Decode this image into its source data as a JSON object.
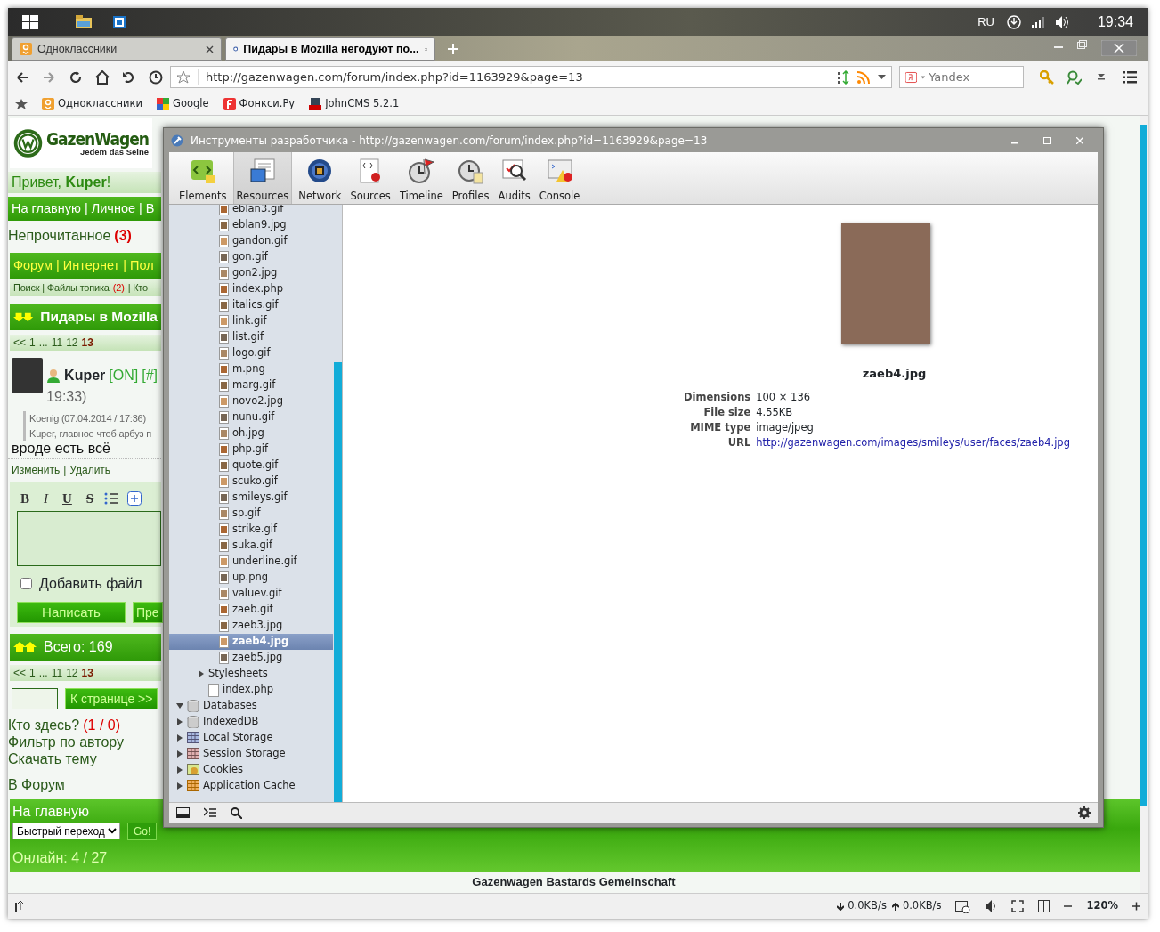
{
  "taskbar": {
    "language": "RU",
    "clock": "19:34"
  },
  "tabs": [
    {
      "label": "Одноклассники",
      "selected": false
    },
    {
      "label": "Пидары в Mozilla негодуют по...",
      "selected": true
    }
  ],
  "address_bar": {
    "url": "http://gazenwagen.com/forum/index.php?id=1163929&page=13"
  },
  "search": {
    "placeholder": "Yandex"
  },
  "bookmarks": [
    {
      "label": "Одноклассники",
      "kind": "ok"
    },
    {
      "label": "Google",
      "kind": "google"
    },
    {
      "label": "Фонкси.Ру",
      "kind": "fonksi"
    },
    {
      "label": "JohnCMS 5.2.1",
      "kind": "cms"
    }
  ],
  "page": {
    "logo": {
      "title": "GazenWagen",
      "slogan": "Jedem das Seine"
    },
    "greeting": "Привет, **Kuper**!",
    "nav": "На главную | Личное | В",
    "unread": {
      "label": "Непрочитанное",
      "count": "(3)"
    },
    "menu": "Форум | Интернет | Пол",
    "submenu": {
      "before": "Поиск | Файлы топика",
      "count": "(2)",
      "after": "| Кто"
    },
    "topic_title": "Пидары в Mozilla",
    "pager": [
      {
        "label": "<<",
        "selected": false
      },
      {
        "label": "1",
        "selected": false
      },
      {
        "label": "...",
        "selected": false
      },
      {
        "label": "11",
        "selected": false
      },
      {
        "label": "12",
        "selected": false
      },
      {
        "label": "13",
        "selected": true
      }
    ],
    "post": {
      "author": "Kuper",
      "status": "[ON]",
      "anchor": "[#]",
      "time": "19:33)",
      "quote_head": "Koenig (07.04.2014 / 17:36)",
      "quote_text": "Kuper, главное чтоб арбуз п",
      "text": "вроде есть всё",
      "actions": [
        "Изменить",
        "Удалить"
      ],
      "action_separator": "|"
    },
    "editor": {
      "format_buttons": [
        "B",
        "I",
        "U",
        "S"
      ],
      "add_file": {
        "label": "Добавить файл",
        "checked": false
      },
      "buttons": [
        "Написать",
        "Пре"
      ]
    },
    "total": "Всего: 169",
    "pager_bottom": [
      {
        "label": "<<",
        "selected": false
      },
      {
        "label": "1",
        "selected": false
      },
      {
        "label": "...",
        "selected": false
      },
      {
        "label": "11",
        "selected": false
      },
      {
        "label": "12",
        "selected": false
      },
      {
        "label": "13",
        "selected": true
      }
    ],
    "goto_button": "К странице >>",
    "who_here": {
      "label": "Кто здесь?",
      "count": "(1 / 0)"
    },
    "links": [
      "Фильтр по автору",
      "Скачать тему"
    ],
    "forum_link": "В Форум",
    "footer": {
      "home": "На главную",
      "quick_jump": "Быстрый переход",
      "go": "Go!",
      "online": "Онлайн: 4 / 27",
      "copyright": "Gazenwagen Bastards Gemeinschaft"
    }
  },
  "devtools": {
    "title": "Инструменты разработчика - http://gazenwagen.com/forum/index.php?id=1163929&page=13",
    "panels": [
      {
        "label": "Elements",
        "kind": "elements",
        "selected": false
      },
      {
        "label": "Resources",
        "kind": "resources",
        "selected": true
      },
      {
        "label": "Network",
        "kind": "network",
        "selected": false
      },
      {
        "label": "Sources",
        "kind": "sources",
        "selected": false
      },
      {
        "label": "Timeline",
        "kind": "timeline",
        "selected": false
      },
      {
        "label": "Profiles",
        "kind": "profiles",
        "selected": false
      },
      {
        "label": "Audits",
        "kind": "audits",
        "selected": false
      },
      {
        "label": "Console",
        "kind": "console",
        "selected": false
      }
    ],
    "image_files": [
      {
        "label": "eblan3.gif",
        "selected": false
      },
      {
        "label": "eblan9.jpg",
        "selected": false
      },
      {
        "label": "gandon.gif",
        "selected": false
      },
      {
        "label": "gon.gif",
        "selected": false
      },
      {
        "label": "gon2.jpg",
        "selected": false
      },
      {
        "label": "index.php",
        "selected": false
      },
      {
        "label": "italics.gif",
        "selected": false
      },
      {
        "label": "link.gif",
        "selected": false
      },
      {
        "label": "list.gif",
        "selected": false
      },
      {
        "label": "logo.gif",
        "selected": false
      },
      {
        "label": "m.png",
        "selected": false
      },
      {
        "label": "marg.gif",
        "selected": false
      },
      {
        "label": "novo2.jpg",
        "selected": false
      },
      {
        "label": "nunu.gif",
        "selected": false
      },
      {
        "label": "oh.jpg",
        "selected": false
      },
      {
        "label": "php.gif",
        "selected": false
      },
      {
        "label": "quote.gif",
        "selected": false
      },
      {
        "label": "scuko.gif",
        "selected": false
      },
      {
        "label": "smileys.gif",
        "selected": false
      },
      {
        "label": "sp.gif",
        "selected": false
      },
      {
        "label": "strike.gif",
        "selected": false
      },
      {
        "label": "suka.gif",
        "selected": false
      },
      {
        "label": "underline.gif",
        "selected": false
      },
      {
        "label": "up.png",
        "selected": false
      },
      {
        "label": "valuev.gif",
        "selected": false
      },
      {
        "label": "zaeb.gif",
        "selected": false
      },
      {
        "label": "zaeb3.jpg",
        "selected": false
      },
      {
        "label": "zaeb4.jpg",
        "selected": true
      },
      {
        "label": "zaeb5.jpg",
        "selected": false
      }
    ],
    "frame_items": [
      {
        "label": "Stylesheets",
        "kind": "folder",
        "expanded": false
      },
      {
        "label": "index.php",
        "kind": "document"
      }
    ],
    "storage": [
      {
        "label": "Databases",
        "kind": "database",
        "expanded": true
      },
      {
        "label": "IndexedDB",
        "kind": "database",
        "expanded": false
      },
      {
        "label": "Local Storage",
        "kind": "local",
        "expanded": false
      },
      {
        "label": "Session Storage",
        "kind": "session",
        "expanded": false
      },
      {
        "label": "Cookies",
        "kind": "cookies",
        "expanded": false
      },
      {
        "label": "Application Cache",
        "kind": "appcache",
        "expanded": false
      }
    ],
    "resource": {
      "name": "zaeb4.jpg",
      "details": [
        {
          "label": "Dimensions",
          "value": "100 × 136",
          "kind": "text"
        },
        {
          "label": "File size",
          "value": "4.55KB",
          "kind": "text"
        },
        {
          "label": "MIME type",
          "value": "image/jpeg",
          "kind": "text"
        },
        {
          "label": "URL",
          "value": "http://gazenwagen.com/images/smileys/user/faces/zaeb4.jpg",
          "kind": "link"
        }
      ]
    }
  },
  "status_bar": {
    "download": "0.0KB/s",
    "upload": "0.0KB/s",
    "zoom": "120%"
  }
}
